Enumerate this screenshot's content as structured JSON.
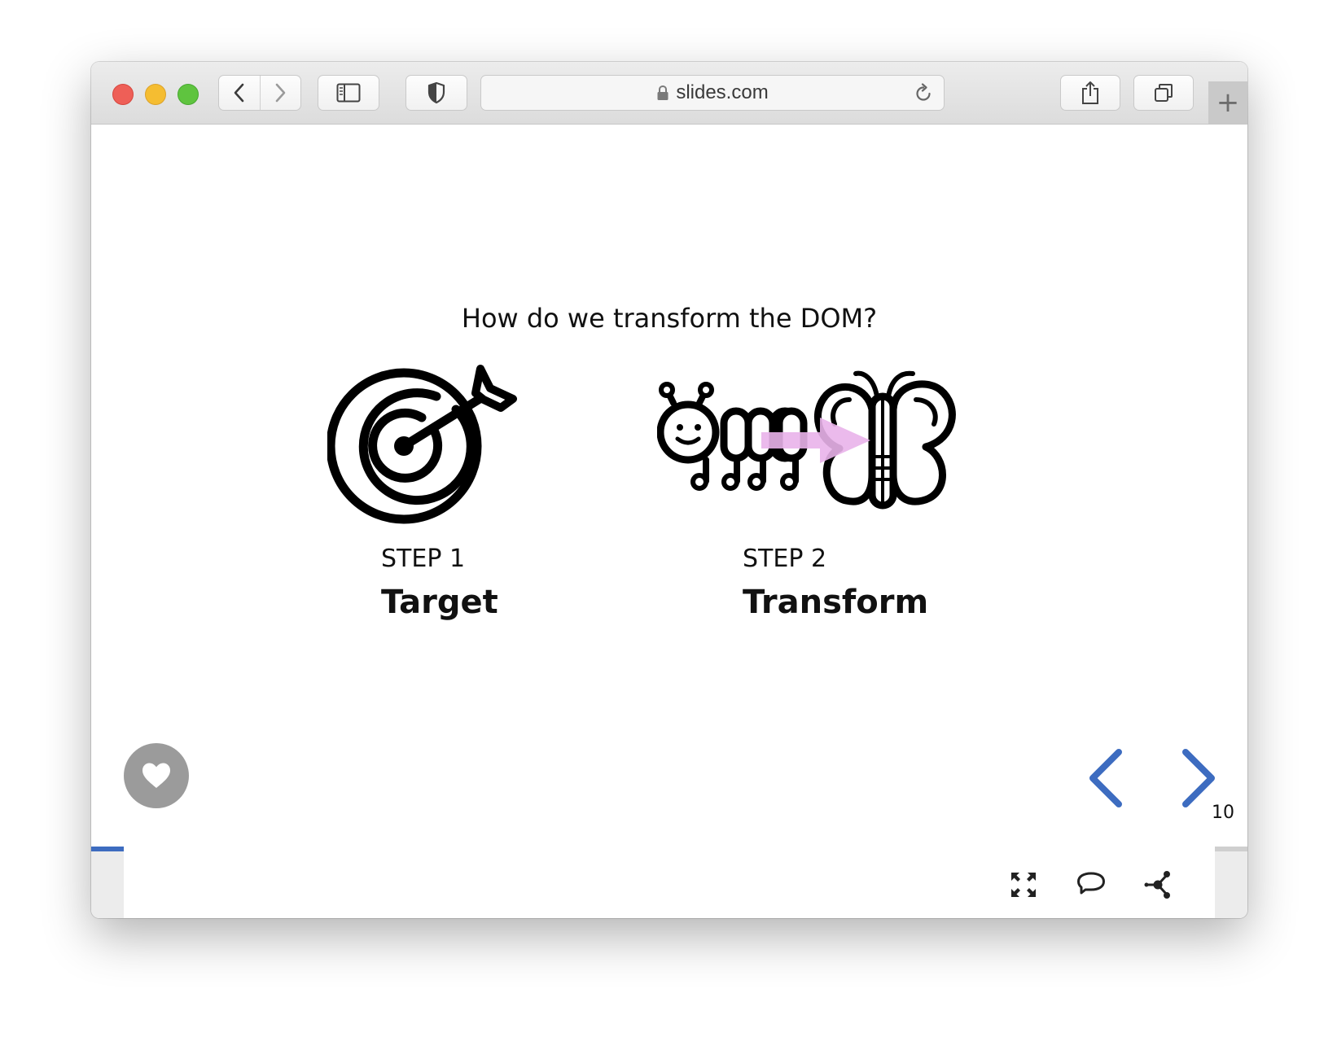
{
  "browser": {
    "url": "slides.com",
    "buttons": {
      "close": "close-window",
      "minimize": "minimize-window",
      "zoom": "zoom-window",
      "new_tab_label": "+"
    },
    "icons": [
      "chevron-left-icon",
      "chevron-right-icon",
      "sidebar-icon",
      "shield-icon",
      "lock-icon",
      "reload-icon",
      "share-icon",
      "tabs-icon"
    ]
  },
  "slide": {
    "title": "How do we transform the DOM?",
    "steps": [
      {
        "label": "STEP 1",
        "name": "Target",
        "icon": "target-icon"
      },
      {
        "label": "STEP 2",
        "name": "Transform",
        "icon": "caterpillar-butterfly-icon"
      }
    ],
    "slide_number": "10",
    "progress": 0.2,
    "accent_color": "#3d6cc0",
    "arrow_color": "#e9b2ea"
  },
  "controls": {
    "like": "heart-icon",
    "prev": "chevron-left-icon",
    "next": "chevron-right-icon"
  },
  "footer": {
    "icons": [
      "fullscreen-icon",
      "comment-icon",
      "share-graph-icon"
    ]
  }
}
